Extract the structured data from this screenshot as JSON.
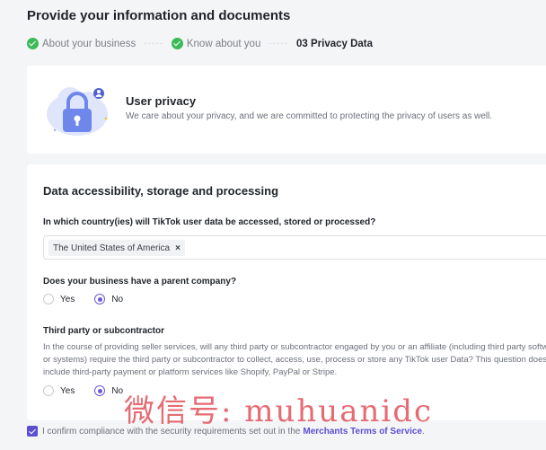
{
  "page": {
    "title": "Provide your information and documents"
  },
  "steps": [
    {
      "label": "About your business",
      "state": "done"
    },
    {
      "label": "Know about you",
      "state": "done"
    },
    {
      "label": "03 Privacy Data",
      "state": "active"
    }
  ],
  "privacy": {
    "title": "User privacy",
    "description": "We care about your privacy, and we are committed to protecting the privacy of users as well.",
    "illustration_icon": "lock-icon"
  },
  "data_section": {
    "title": "Data accessibility, storage and processing",
    "q_country": {
      "label": "In which country(ies) will TikTok user data be accessed, stored or processed?",
      "selected_tags": [
        "The United States of America"
      ]
    },
    "q_parent": {
      "label": "Does your business have a parent company?",
      "options": [
        "Yes",
        "No"
      ],
      "selected": "No"
    },
    "q_third_party": {
      "label": "Third party or subcontractor",
      "description": "In the course of providing seller services, will any third party or subcontractor engaged by you or an affiliate (including third party software or systems) require the third party or subcontractor to collect, access, use, process or store any TikTok user Data? This question does not include third-party payment or platform services like Shopify, PayPal or Stripe.",
      "options": [
        "Yes",
        "No"
      ],
      "selected": "No"
    }
  },
  "confirm": {
    "checked": true,
    "text": "I confirm compliance with the security requirements set out in the",
    "link": "Merchants Terms of Service",
    "suffix": "."
  },
  "watermark": "微信号: muhuanidc",
  "colors": {
    "accent": "#5b4fd1",
    "success": "#3cba58",
    "background": "#f4f5f7"
  }
}
